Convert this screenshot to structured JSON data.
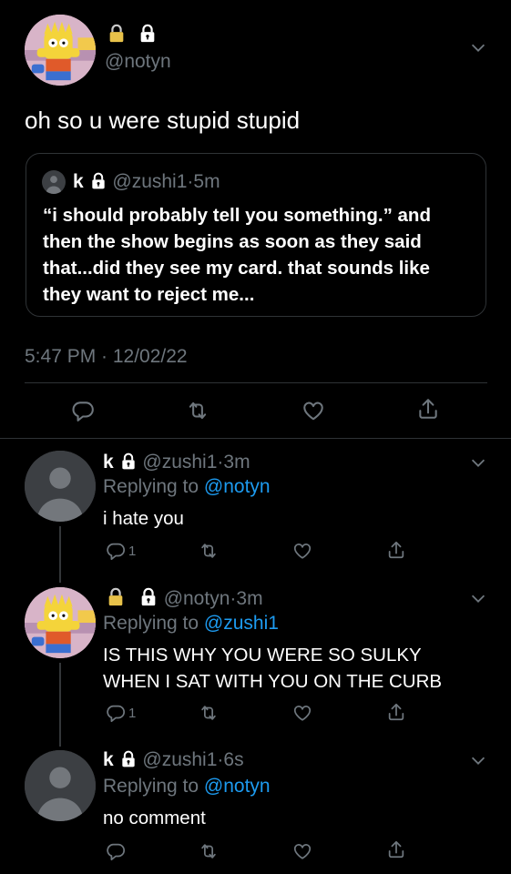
{
  "main_tweet": {
    "handle": "@notyn",
    "text": "oh so u were stupid stupid",
    "quote": {
      "name": "k",
      "handle": "@zushi1",
      "separator": "·",
      "time": "5m",
      "text": "“i should probably tell you something.” and then the show begins as soon as they said that...did they see my card. that sounds like they want to reject me..."
    },
    "timestamp": "5:47 PM · 12/02/22"
  },
  "replies": [
    {
      "name": "k",
      "handle": "@zushi1",
      "separator": "·",
      "time": "3m",
      "replying_label": "Replying to",
      "replying_handle": "@notyn",
      "text": "i hate you",
      "reply_count": "1"
    },
    {
      "handle": "@notyn",
      "separator": "·",
      "time": "3m",
      "replying_label": "Replying to",
      "replying_handle": "@zushi1",
      "text_line1": "IS THIS WHY YOU WERE SO SULKY",
      "text_line2": "WHEN I SAT WITH YOU ON THE CURB",
      "reply_count": "1"
    },
    {
      "name": "k",
      "handle": "@zushi1",
      "separator": "·",
      "time": "6s",
      "replying_label": "Replying to",
      "replying_handle": "@notyn",
      "text": "no comment"
    }
  ],
  "colors": {
    "background": "#000000",
    "muted": "#6e767d",
    "link": "#1d9bf0",
    "border": "#2f3336"
  },
  "icons": [
    "lock-icon",
    "chevron-down-icon",
    "reply-icon",
    "retweet-icon",
    "like-icon",
    "share-icon"
  ]
}
